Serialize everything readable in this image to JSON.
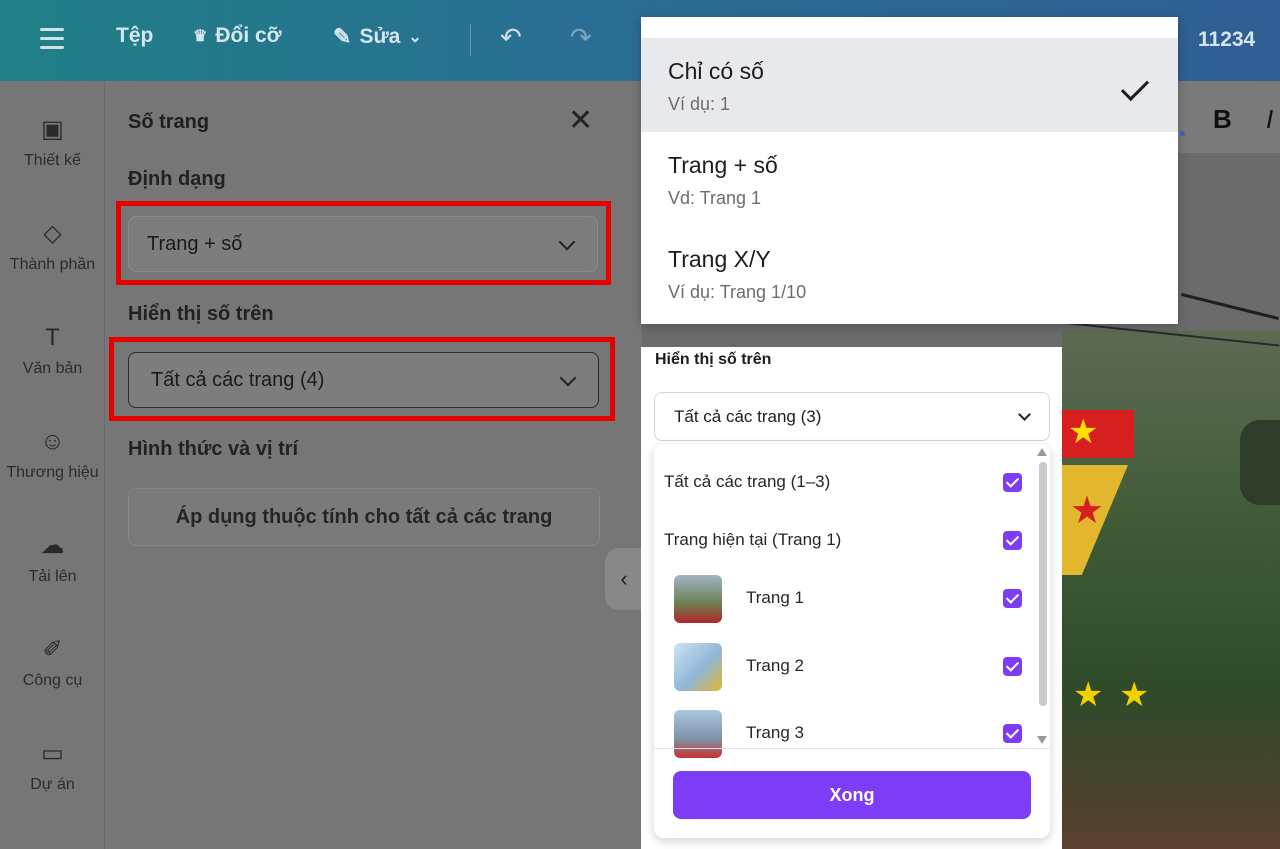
{
  "topbar": {
    "file": "Tệp",
    "resize": "Đổi cỡ",
    "edit": "Sửa",
    "number": "11234"
  },
  "rail": [
    {
      "label": "Thiết kế",
      "icon": "layout-icon"
    },
    {
      "label": "Thành phần",
      "icon": "shapes-icon"
    },
    {
      "label": "Văn bản",
      "icon": "text-icon"
    },
    {
      "label": "Thương hiệu",
      "icon": "brand-icon"
    },
    {
      "label": "Tải lên",
      "icon": "cloud-upload-icon"
    },
    {
      "label": "Công cụ",
      "icon": "pen-tool-icon"
    },
    {
      "label": "Dự án",
      "icon": "folder-icon"
    }
  ],
  "panel": {
    "title": "Số trang",
    "format_label": "Định dạng",
    "format_value": "Trang + số",
    "display_label": "Hiển thị số trên",
    "display_value": "Tất cả các trang (4)",
    "style_label": "Hình thức và vị trí",
    "apply_button": "Áp dụng thuộc tính cho tất cả các trang"
  },
  "format_menu": {
    "options": [
      {
        "title": "Chỉ có số",
        "subtitle": "Ví dụ: 1",
        "selected": true
      },
      {
        "title": "Trang + số",
        "subtitle": "Vd: Trang 1",
        "selected": false
      },
      {
        "title": "Trang X/Y",
        "subtitle": "Ví dụ: Trang 1/10",
        "selected": false
      }
    ]
  },
  "pages_popover": {
    "label": "Hiển thị số trên",
    "select_value": "Tất cả các trang (3)",
    "rows": [
      {
        "label": "Tất cả các trang (1–3)",
        "checked": true
      },
      {
        "label": "Trang hiện tại (Trang 1)",
        "checked": true
      },
      {
        "label": "Trang 1",
        "checked": true
      },
      {
        "label": "Trang 2",
        "checked": true
      },
      {
        "label": "Trang 3",
        "checked": true
      }
    ],
    "done_button": "Xong"
  },
  "toolbar": {
    "bold": "B",
    "italic": "I"
  },
  "colors": {
    "accent": "#7d3cf5",
    "highlight_frame": "#e60000",
    "topbar_start": "#1f7f86",
    "topbar_end": "#2f5e95"
  }
}
